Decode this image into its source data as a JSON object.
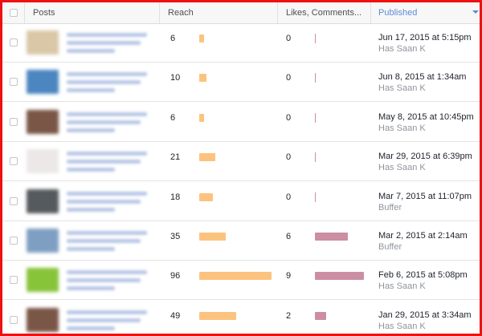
{
  "header": {
    "posts_label": "Posts",
    "reach_label": "Reach",
    "engagement_label": "Likes, Comments...",
    "published_label": "Published"
  },
  "colors": {
    "frame_border": "#ee1111",
    "reach_bar": "#fcc37f",
    "engagement_bar": "#cc8ea2",
    "sort_accent": "#5b8cd6"
  },
  "bar_scale": {
    "reach_max": 96,
    "engagement_max": 9
  },
  "rows": [
    {
      "reach": "6",
      "engagement": "0",
      "published": "Jun 17, 2015 at 5:15pm",
      "author": "Has Saan K",
      "thumb_color": "#d9c7a8"
    },
    {
      "reach": "10",
      "engagement": "0",
      "published": "Jun 8, 2015 at 1:34am",
      "author": "Has Saan K",
      "thumb_color": "#4c86c0"
    },
    {
      "reach": "6",
      "engagement": "0",
      "published": "May 8, 2015 at 10:45pm",
      "author": "Has Saan K",
      "thumb_color": "#7a5647"
    },
    {
      "reach": "21",
      "engagement": "0",
      "published": "Mar 29, 2015 at 6:39pm",
      "author": "Has Saan K",
      "thumb_color": "#ece8e8"
    },
    {
      "reach": "18",
      "engagement": "0",
      "published": "Mar 7, 2015 at 11:07pm",
      "author": "Buffer",
      "thumb_color": "#555a5e"
    },
    {
      "reach": "35",
      "engagement": "6",
      "published": "Mar 2, 2015 at 2:14am",
      "author": "Buffer",
      "thumb_color": "#7e9fc2"
    },
    {
      "reach": "96",
      "engagement": "9",
      "published": "Feb 6, 2015 at 5:08pm",
      "author": "Has Saan K",
      "thumb_color": "#88c43a"
    },
    {
      "reach": "49",
      "engagement": "2",
      "published": "Jan 29, 2015 at 3:34am",
      "author": "Has Saan K",
      "thumb_color": "#7a5647"
    }
  ]
}
